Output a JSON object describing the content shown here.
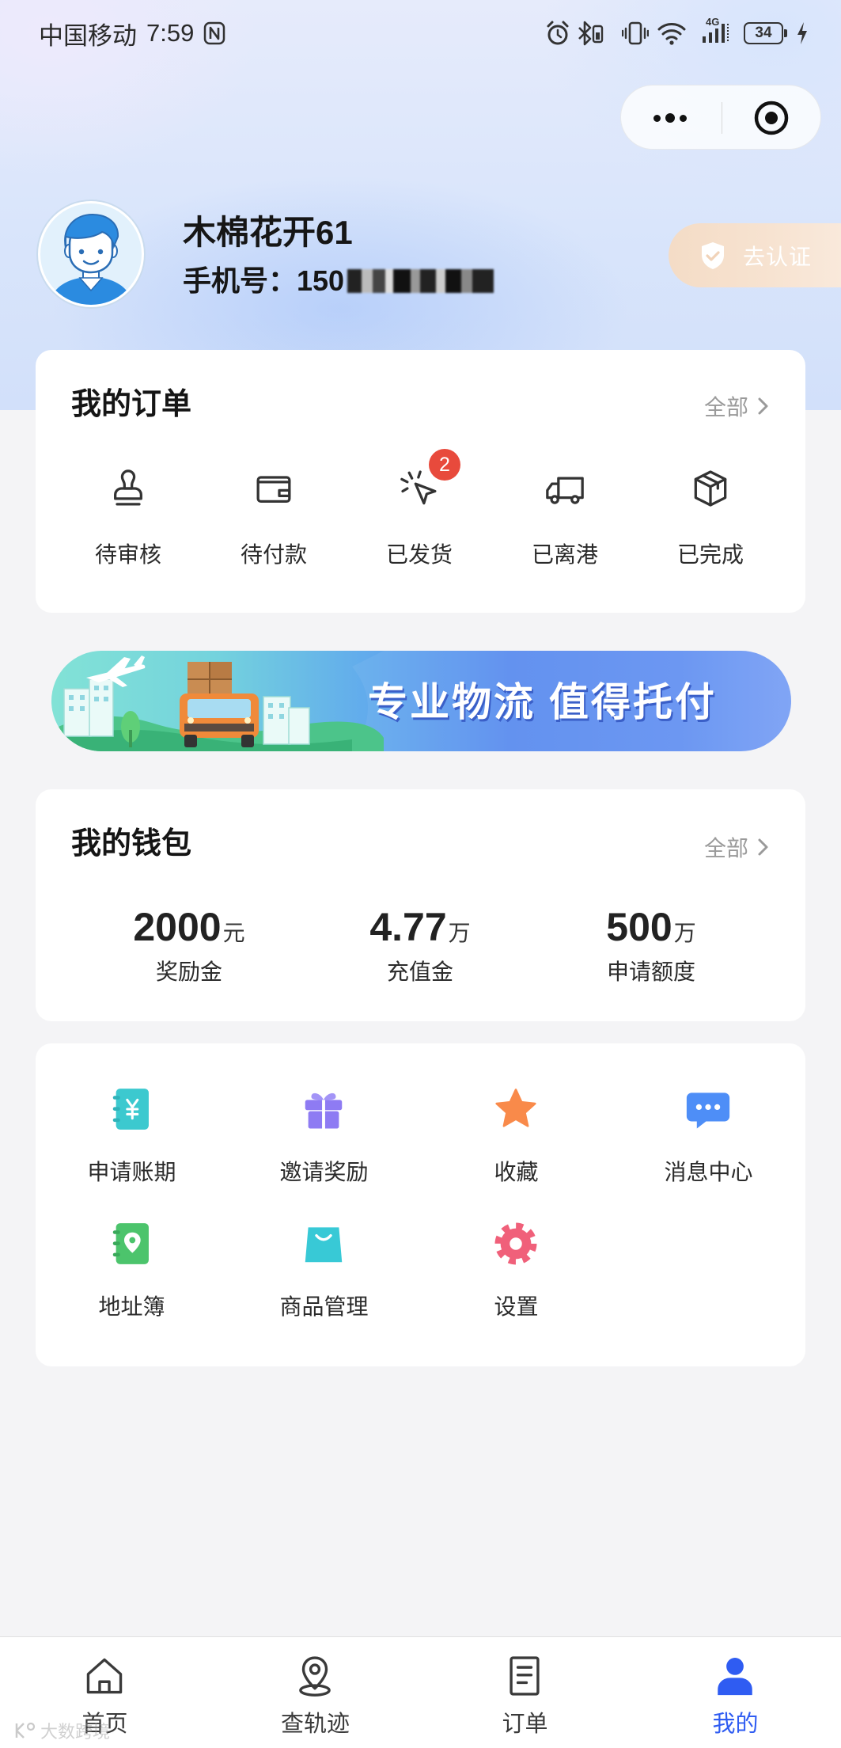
{
  "status_bar": {
    "carrier": "中国移动",
    "time": "7:59",
    "network": "4G",
    "battery": "34",
    "icons": [
      "nfc-icon",
      "alarm-icon",
      "bluetooth-icon",
      "vibrate-icon",
      "wifi-icon",
      "signal-icon",
      "battery-icon",
      "charging-icon"
    ]
  },
  "capsule": {
    "more_icon": "more-dots-icon",
    "close_icon": "target-circle-icon"
  },
  "profile": {
    "name": "木棉花开61",
    "phone_label": "手机号：",
    "phone_prefix": "150",
    "verify_label": "去认证",
    "verify_icon": "shield-check-icon"
  },
  "orders": {
    "title": "我的订单",
    "all_label": "全部",
    "items": [
      {
        "label": "待审核",
        "icon": "stamp-icon"
      },
      {
        "label": "待付款",
        "icon": "wallet-icon"
      },
      {
        "label": "已发货",
        "icon": "click-cursor-icon",
        "badge": "2"
      },
      {
        "label": "已离港",
        "icon": "truck-icon"
      },
      {
        "label": "已完成",
        "icon": "box-icon"
      }
    ]
  },
  "banner": {
    "text": "专业物流 值得托付"
  },
  "wallet": {
    "title": "我的钱包",
    "all_label": "全部",
    "items": [
      {
        "value": "2000",
        "unit": "元",
        "label": "奖励金"
      },
      {
        "value": "4.77",
        "unit": "万",
        "label": "充值金"
      },
      {
        "value": "500",
        "unit": "万",
        "label": "申请额度"
      }
    ]
  },
  "services": {
    "items": [
      {
        "label": "申请账期",
        "icon": "bill-notebook-icon",
        "color": "#3cc9cf"
      },
      {
        "label": "邀请奖励",
        "icon": "gift-icon",
        "color": "#8e7bf3"
      },
      {
        "label": "收藏",
        "icon": "star-icon",
        "color": "#f98a4a"
      },
      {
        "label": "消息中心",
        "icon": "chat-bubble-icon",
        "color": "#4e8ef7"
      },
      {
        "label": "地址簿",
        "icon": "address-book-icon",
        "color": "#4cc46c"
      },
      {
        "label": "商品管理",
        "icon": "shopping-bag-icon",
        "color": "#38c9d6"
      },
      {
        "label": "设置",
        "icon": "gear-icon",
        "color": "#f0607a"
      }
    ]
  },
  "tabbar": {
    "items": [
      {
        "label": "首页",
        "icon": "home-icon",
        "active": false
      },
      {
        "label": "查轨迹",
        "icon": "location-pin-icon",
        "active": false
      },
      {
        "label": "订单",
        "icon": "document-icon",
        "active": false
      },
      {
        "label": "我的",
        "icon": "user-icon",
        "active": true
      }
    ]
  },
  "watermark": "大数跨境",
  "colors": {
    "accent": "#2f5cf2",
    "badge": "#e84a3c",
    "page_bg": "#f4f4f6",
    "header_bg": "#d9e5fb",
    "verify_bg": "#f4dcc6"
  }
}
